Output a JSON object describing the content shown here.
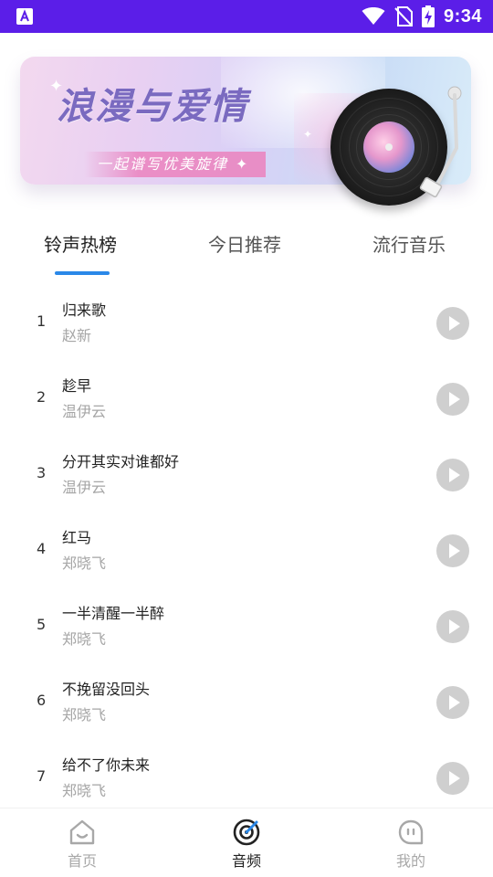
{
  "status_bar": {
    "time": "9:34",
    "icons": [
      "app-notification-icon",
      "wifi-icon",
      "no-sim-icon",
      "battery-charging-icon"
    ],
    "bg_color": "#5b1ee8"
  },
  "banner": {
    "title": "浪漫与爱情",
    "subtitle": "一起谱写优美旋律"
  },
  "tabs": [
    {
      "label": "铃声热榜",
      "active": true
    },
    {
      "label": "今日推荐",
      "active": false
    },
    {
      "label": "流行音乐",
      "active": false
    }
  ],
  "accent_color": "#2a88e8",
  "songs": [
    {
      "index": "1",
      "title": "归来歌",
      "artist": "赵新"
    },
    {
      "index": "2",
      "title": "趁早",
      "artist": "温伊云"
    },
    {
      "index": "3",
      "title": "分开其实对谁都好",
      "artist": "温伊云"
    },
    {
      "index": "4",
      "title": "红马",
      "artist": "郑晓飞"
    },
    {
      "index": "5",
      "title": "一半清醒一半醉",
      "artist": "郑晓飞"
    },
    {
      "index": "6",
      "title": "不挽留没回头",
      "artist": "郑晓飞"
    },
    {
      "index": "7",
      "title": "给不了你未来",
      "artist": "郑晓飞"
    }
  ],
  "bottom_nav": [
    {
      "label": "首页",
      "icon": "home-icon",
      "active": false
    },
    {
      "label": "音频",
      "icon": "audio-disc-icon",
      "active": true
    },
    {
      "label": "我的",
      "icon": "profile-icon",
      "active": false
    }
  ]
}
